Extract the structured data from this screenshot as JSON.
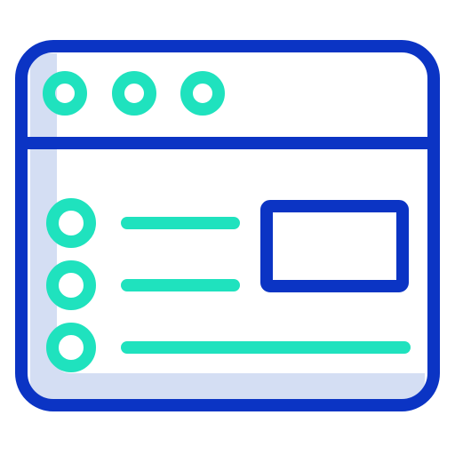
{
  "icon": {
    "name": "browser-window-list-icon",
    "colors": {
      "frame": "#0B34C4",
      "accent": "#1FE2BE",
      "shadow": "#D4DEF3",
      "background": "#FFFFFF"
    },
    "parts": {
      "window_dots": 3,
      "list_bullets": 3,
      "list_lines": 3,
      "image_placeholder": 1
    }
  }
}
